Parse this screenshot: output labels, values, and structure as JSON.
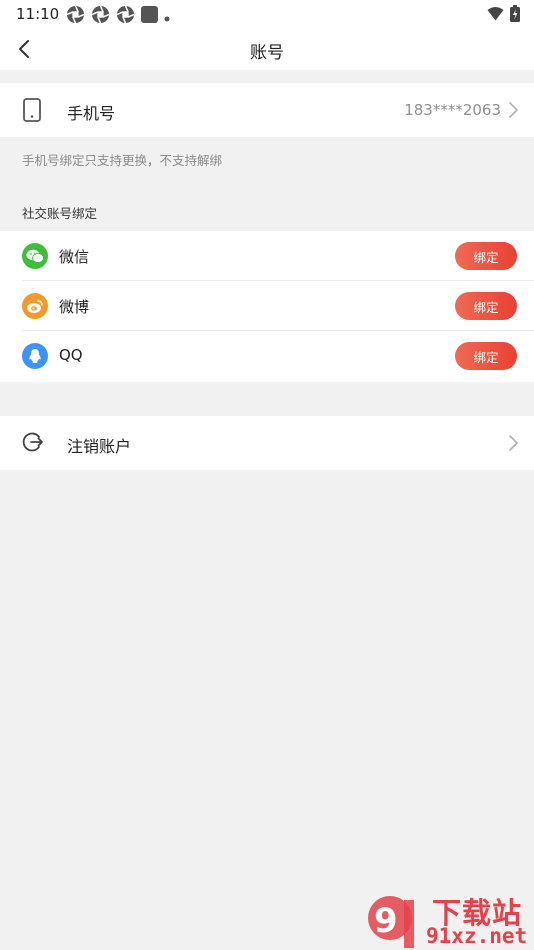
{
  "status_bar": {
    "time": "11:10"
  },
  "app_bar": {
    "title": "账号"
  },
  "phone": {
    "label": "手机号",
    "value": "183****2063",
    "hint": "手机号绑定只支持更换，不支持解绑"
  },
  "social": {
    "section_title": "社交账号绑定",
    "items": [
      {
        "name": "微信",
        "button": "绑定",
        "icon": "wechat-icon",
        "color": "#3dbf3c"
      },
      {
        "name": "微博",
        "button": "绑定",
        "icon": "weibo-icon",
        "color": "#f49a2c"
      },
      {
        "name": "QQ",
        "button": "绑定",
        "icon": "qq-icon",
        "color": "#3d94f7"
      }
    ]
  },
  "logout": {
    "label": "注销账户"
  },
  "watermark": {
    "line1": "下载站",
    "line2": "91xz.net"
  },
  "colors": {
    "button": "#e84133",
    "background": "#f1f1f1"
  }
}
